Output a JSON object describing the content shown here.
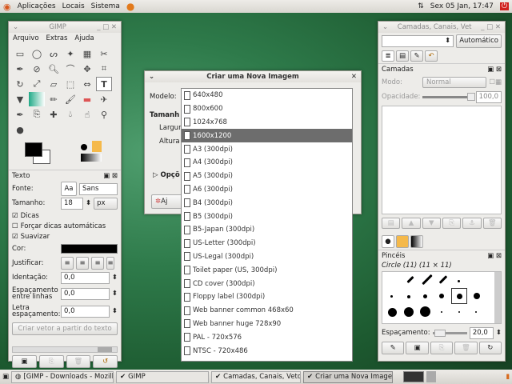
{
  "top_panel": {
    "menus": [
      "Aplicações",
      "Locais",
      "Sistema"
    ],
    "clock": "Sex 05 Jan, 17:47"
  },
  "toolbox": {
    "title": "GIMP",
    "menu": [
      "Arquivo",
      "Extras",
      "Ajuda"
    ]
  },
  "text_options": {
    "title": "Texto",
    "font_label": "Fonte:",
    "font_preview": "Aa",
    "font_value": "Sans",
    "size_label": "Tamanho:",
    "size_value": "18",
    "unit": "px",
    "hinting": "Dicas",
    "force_autohint": "Forçar dicas automáticas",
    "antialias": "Suavizar",
    "color_label": "Cor:",
    "justify_label": "Justificar:",
    "indent_label": "Identação:",
    "indent_value": "0,0",
    "line_spacing_label": "Espaçamento entre linhas",
    "line_spacing_value": "0,0",
    "letter_spacing_label": "Letra espaçamento:",
    "letter_spacing_value": "0,0",
    "path_button": "Criar vetor a partir do texto"
  },
  "dialog": {
    "title": "Criar uma Nova Imagem",
    "template_label": "Modelo:",
    "size_label": "Tamanh",
    "width_label": "Largur",
    "height_label": "Altura",
    "options_label": "Opçõ",
    "help_button": "Aj",
    "templates": [
      "640x480",
      "800x600",
      "1024x768",
      "1600x1200",
      "A3 (300dpi)",
      "A4 (300dpi)",
      "A5 (300dpi)",
      "A6 (300dpi)",
      "B4 (300dpi)",
      "B5 (300dpi)",
      "B5-Japan (300dpi)",
      "US-Letter (300dpi)",
      "US-Legal (300dpi)",
      "Toilet paper (US, 300dpi)",
      "CD cover (300dpi)",
      "Floppy label (300dpi)",
      "Web banner common 468x60",
      "Web banner huge 728x90",
      "PAL - 720x576",
      "NTSC - 720x486"
    ],
    "selected_index": 3
  },
  "layers": {
    "title": "Camadas, Canais, Vet",
    "auto_button": "Automático",
    "panel_title": "Camadas",
    "mode_label": "Modo:",
    "mode_value": "Normal",
    "opacity_label": "Opacidade:",
    "opacity_value": "100,0"
  },
  "brushes": {
    "title": "Pincéis",
    "current": "Circle (11) (11 × 11)",
    "spacing_label": "Espaçamento:",
    "spacing_value": "20,0"
  },
  "taskbar": {
    "items": [
      "[GIMP - Downloads - Mozilla ...",
      "GIMP",
      "Camadas, Canais, Vetores, ...",
      "Criar uma Nova Imagem"
    ],
    "active_index": 3
  },
  "colors": {
    "fg": "#000000",
    "bg": "#ffffff",
    "accent": "#f5b94a",
    "desktop": "#2e7a4a"
  }
}
